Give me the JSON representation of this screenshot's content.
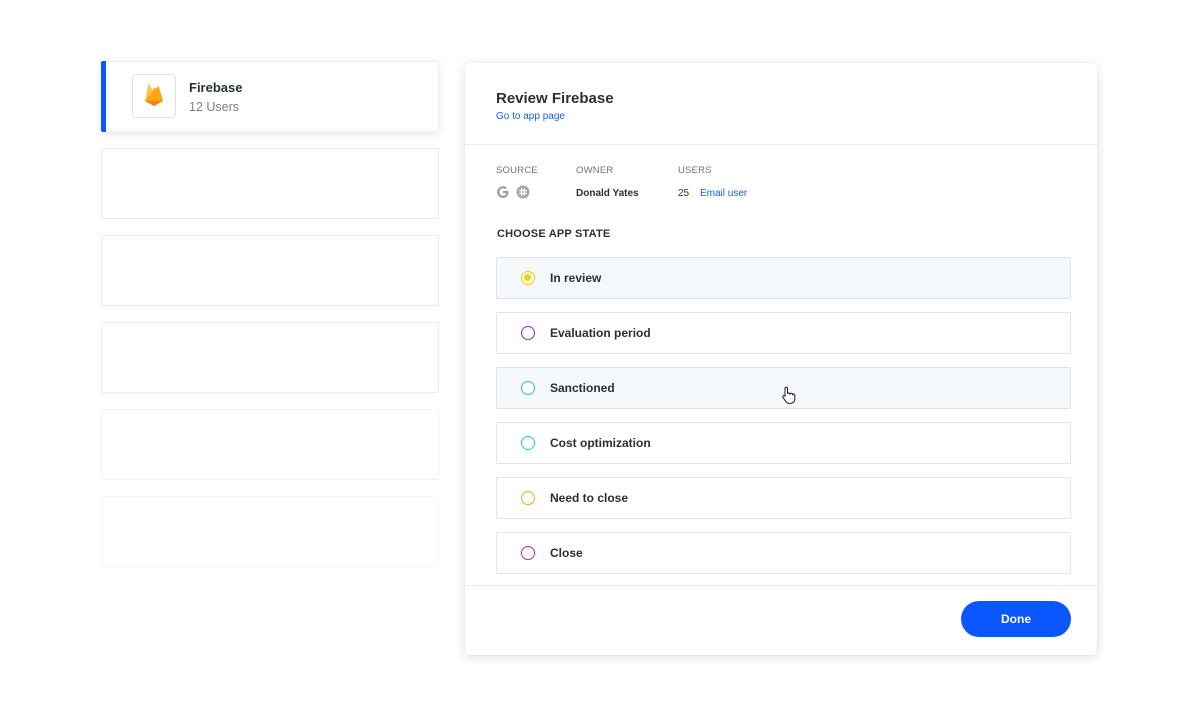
{
  "apps": [
    {
      "name": "Firebase",
      "users": "12 Users",
      "logo": "firebase-flame-icon"
    }
  ],
  "review": {
    "title": "Review Firebase",
    "app_page_link": "Go to app page",
    "source_label": "SOURCE",
    "source_icons": [
      "google-icon",
      "slack-icon"
    ],
    "owner_label": "OWNER",
    "owner_value": "Donald Yates",
    "users_label": "USERS",
    "users_value": "25",
    "email_link": "Email user",
    "choose_state_title": "CHOOSE APP STATE",
    "states": [
      {
        "label": "In review",
        "color": "#f2c600",
        "selected": true
      },
      {
        "label": "Evaluation period",
        "color": "#8a2be2",
        "selected": false
      },
      {
        "label": "Sanctioned",
        "color": "#2ec4c4",
        "selected": false
      },
      {
        "label": "Cost optimization",
        "color": "#2cc9d6",
        "selected": false
      },
      {
        "label": "Need to close",
        "color": "#f2a62a",
        "selected": false
      },
      {
        "label": "Close",
        "color": "#e0266a",
        "selected": false
      }
    ],
    "done_label": "Done"
  },
  "colors": {
    "accent": "#0a56ff",
    "link": "#1660e8"
  }
}
